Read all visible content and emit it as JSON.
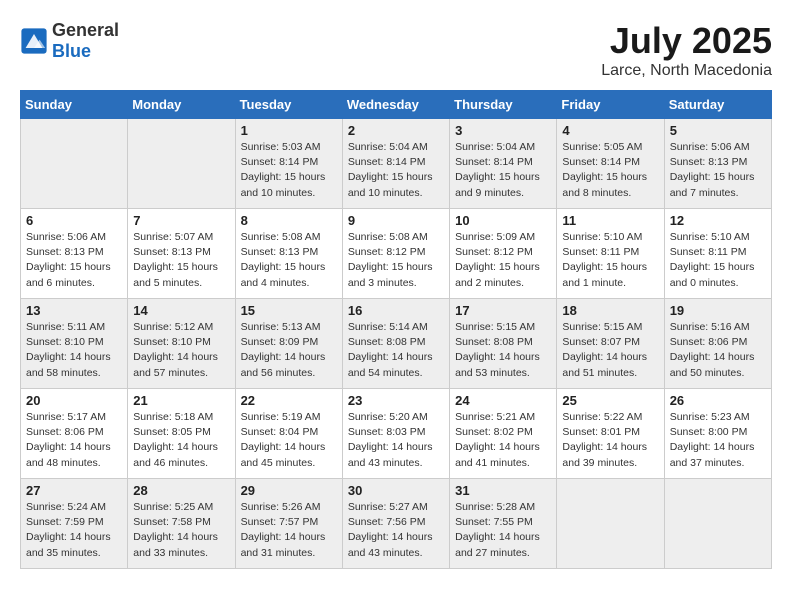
{
  "header": {
    "logo_general": "General",
    "logo_blue": "Blue",
    "month": "July 2025",
    "location": "Larce, North Macedonia"
  },
  "days_of_week": [
    "Sunday",
    "Monday",
    "Tuesday",
    "Wednesday",
    "Thursday",
    "Friday",
    "Saturday"
  ],
  "weeks": [
    [
      {
        "day": "",
        "sunrise": "",
        "sunset": "",
        "daylight": ""
      },
      {
        "day": "",
        "sunrise": "",
        "sunset": "",
        "daylight": ""
      },
      {
        "day": "1",
        "sunrise": "Sunrise: 5:03 AM",
        "sunset": "Sunset: 8:14 PM",
        "daylight": "Daylight: 15 hours and 10 minutes."
      },
      {
        "day": "2",
        "sunrise": "Sunrise: 5:04 AM",
        "sunset": "Sunset: 8:14 PM",
        "daylight": "Daylight: 15 hours and 10 minutes."
      },
      {
        "day": "3",
        "sunrise": "Sunrise: 5:04 AM",
        "sunset": "Sunset: 8:14 PM",
        "daylight": "Daylight: 15 hours and 9 minutes."
      },
      {
        "day": "4",
        "sunrise": "Sunrise: 5:05 AM",
        "sunset": "Sunset: 8:14 PM",
        "daylight": "Daylight: 15 hours and 8 minutes."
      },
      {
        "day": "5",
        "sunrise": "Sunrise: 5:06 AM",
        "sunset": "Sunset: 8:13 PM",
        "daylight": "Daylight: 15 hours and 7 minutes."
      }
    ],
    [
      {
        "day": "6",
        "sunrise": "Sunrise: 5:06 AM",
        "sunset": "Sunset: 8:13 PM",
        "daylight": "Daylight: 15 hours and 6 minutes."
      },
      {
        "day": "7",
        "sunrise": "Sunrise: 5:07 AM",
        "sunset": "Sunset: 8:13 PM",
        "daylight": "Daylight: 15 hours and 5 minutes."
      },
      {
        "day": "8",
        "sunrise": "Sunrise: 5:08 AM",
        "sunset": "Sunset: 8:13 PM",
        "daylight": "Daylight: 15 hours and 4 minutes."
      },
      {
        "day": "9",
        "sunrise": "Sunrise: 5:08 AM",
        "sunset": "Sunset: 8:12 PM",
        "daylight": "Daylight: 15 hours and 3 minutes."
      },
      {
        "day": "10",
        "sunrise": "Sunrise: 5:09 AM",
        "sunset": "Sunset: 8:12 PM",
        "daylight": "Daylight: 15 hours and 2 minutes."
      },
      {
        "day": "11",
        "sunrise": "Sunrise: 5:10 AM",
        "sunset": "Sunset: 8:11 PM",
        "daylight": "Daylight: 15 hours and 1 minute."
      },
      {
        "day": "12",
        "sunrise": "Sunrise: 5:10 AM",
        "sunset": "Sunset: 8:11 PM",
        "daylight": "Daylight: 15 hours and 0 minutes."
      }
    ],
    [
      {
        "day": "13",
        "sunrise": "Sunrise: 5:11 AM",
        "sunset": "Sunset: 8:10 PM",
        "daylight": "Daylight: 14 hours and 58 minutes."
      },
      {
        "day": "14",
        "sunrise": "Sunrise: 5:12 AM",
        "sunset": "Sunset: 8:10 PM",
        "daylight": "Daylight: 14 hours and 57 minutes."
      },
      {
        "day": "15",
        "sunrise": "Sunrise: 5:13 AM",
        "sunset": "Sunset: 8:09 PM",
        "daylight": "Daylight: 14 hours and 56 minutes."
      },
      {
        "day": "16",
        "sunrise": "Sunrise: 5:14 AM",
        "sunset": "Sunset: 8:08 PM",
        "daylight": "Daylight: 14 hours and 54 minutes."
      },
      {
        "day": "17",
        "sunrise": "Sunrise: 5:15 AM",
        "sunset": "Sunset: 8:08 PM",
        "daylight": "Daylight: 14 hours and 53 minutes."
      },
      {
        "day": "18",
        "sunrise": "Sunrise: 5:15 AM",
        "sunset": "Sunset: 8:07 PM",
        "daylight": "Daylight: 14 hours and 51 minutes."
      },
      {
        "day": "19",
        "sunrise": "Sunrise: 5:16 AM",
        "sunset": "Sunset: 8:06 PM",
        "daylight": "Daylight: 14 hours and 50 minutes."
      }
    ],
    [
      {
        "day": "20",
        "sunrise": "Sunrise: 5:17 AM",
        "sunset": "Sunset: 8:06 PM",
        "daylight": "Daylight: 14 hours and 48 minutes."
      },
      {
        "day": "21",
        "sunrise": "Sunrise: 5:18 AM",
        "sunset": "Sunset: 8:05 PM",
        "daylight": "Daylight: 14 hours and 46 minutes."
      },
      {
        "day": "22",
        "sunrise": "Sunrise: 5:19 AM",
        "sunset": "Sunset: 8:04 PM",
        "daylight": "Daylight: 14 hours and 45 minutes."
      },
      {
        "day": "23",
        "sunrise": "Sunrise: 5:20 AM",
        "sunset": "Sunset: 8:03 PM",
        "daylight": "Daylight: 14 hours and 43 minutes."
      },
      {
        "day": "24",
        "sunrise": "Sunrise: 5:21 AM",
        "sunset": "Sunset: 8:02 PM",
        "daylight": "Daylight: 14 hours and 41 minutes."
      },
      {
        "day": "25",
        "sunrise": "Sunrise: 5:22 AM",
        "sunset": "Sunset: 8:01 PM",
        "daylight": "Daylight: 14 hours and 39 minutes."
      },
      {
        "day": "26",
        "sunrise": "Sunrise: 5:23 AM",
        "sunset": "Sunset: 8:00 PM",
        "daylight": "Daylight: 14 hours and 37 minutes."
      }
    ],
    [
      {
        "day": "27",
        "sunrise": "Sunrise: 5:24 AM",
        "sunset": "Sunset: 7:59 PM",
        "daylight": "Daylight: 14 hours and 35 minutes."
      },
      {
        "day": "28",
        "sunrise": "Sunrise: 5:25 AM",
        "sunset": "Sunset: 7:58 PM",
        "daylight": "Daylight: 14 hours and 33 minutes."
      },
      {
        "day": "29",
        "sunrise": "Sunrise: 5:26 AM",
        "sunset": "Sunset: 7:57 PM",
        "daylight": "Daylight: 14 hours and 31 minutes."
      },
      {
        "day": "30",
        "sunrise": "Sunrise: 5:27 AM",
        "sunset": "Sunset: 7:56 PM",
        "daylight": "Daylight: 14 hours and 43 minutes."
      },
      {
        "day": "31",
        "sunrise": "Sunrise: 5:28 AM",
        "sunset": "Sunset: 7:55 PM",
        "daylight": "Daylight: 14 hours and 27 minutes."
      },
      {
        "day": "",
        "sunrise": "",
        "sunset": "",
        "daylight": ""
      },
      {
        "day": "",
        "sunrise": "",
        "sunset": "",
        "daylight": ""
      }
    ]
  ]
}
